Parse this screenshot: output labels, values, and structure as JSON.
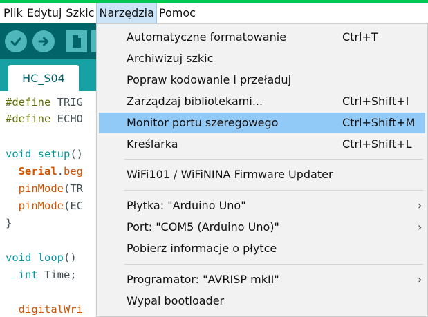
{
  "menubar": {
    "items": [
      "Plik",
      "Edytuj",
      "Szkic",
      "Narzędzia",
      "Pomoc"
    ]
  },
  "toolbar": {
    "buttons": [
      "verify-icon",
      "upload-icon",
      "new-icon",
      "open-icon"
    ]
  },
  "tab": {
    "label": "HC_S04"
  },
  "code": {
    "lines": [
      "#define TRIG",
      "#define ECHO",
      "",
      "void setup()",
      "  Serial.beg",
      "  pinMode(TR",
      "  pinMode(EC",
      "}",
      "",
      "void loop()",
      "  int Time;",
      "",
      "  digitalWri"
    ]
  },
  "menu": {
    "items": [
      {
        "label": "Automatyczne formatowanie",
        "shortcut": "Ctrl+T"
      },
      {
        "label": "Archiwizuj szkic",
        "shortcut": ""
      },
      {
        "label": "Popraw kodowanie i przeładuj",
        "shortcut": ""
      },
      {
        "label": "Zarządzaj bibliotekami...",
        "shortcut": "Ctrl+Shift+I"
      },
      {
        "label": "Monitor portu szeregowego",
        "shortcut": "Ctrl+Shift+M"
      },
      {
        "label": "Kreślarka",
        "shortcut": "Ctrl+Shift+L"
      },
      {
        "label": "WiFi101 / WiFiNINA Firmware Updater",
        "shortcut": ""
      },
      {
        "label": "Płytka: \"Arduino Uno\"",
        "shortcut": ""
      },
      {
        "label": "Port: \"COM5 (Arduino Uno)\"",
        "shortcut": ""
      },
      {
        "label": "Pobierz informacje o płytce",
        "shortcut": ""
      },
      {
        "label": "Programator: \"AVRISP mkII\"",
        "shortcut": ""
      },
      {
        "label": "Wypal bootloader",
        "shortcut": ""
      }
    ],
    "submenu_arrow": "›"
  },
  "colors": {
    "toolbar": "#006468",
    "tabbar": "#17a1a5",
    "highlight": "#91c9f7",
    "accent_line": "#00c853"
  }
}
